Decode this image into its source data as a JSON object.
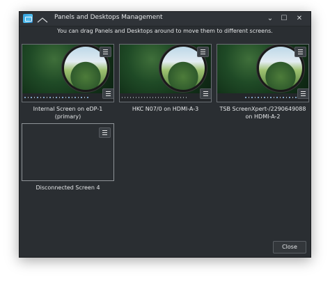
{
  "window": {
    "title": "Panels and Desktops Management",
    "minimize_glyph": "⌄",
    "maximize_glyph": "☐",
    "close_glyph": "✕"
  },
  "hint": "You can drag Panels and Desktops around to move them to different screens.",
  "screens": [
    {
      "label": "Internal Screen on eDP-1 (primary)",
      "icon": "hamburger-menu-icon"
    },
    {
      "label": "HKC N07/0 on HDMI-A-3",
      "icon": "hamburger-menu-icon"
    },
    {
      "label": "TSB ScreenXpert-/2290649088 on HDMI-A-2",
      "icon": "hamburger-menu-icon"
    }
  ],
  "disconnected": {
    "label": "Disconnected Screen 4",
    "icon": "hamburger-menu-icon"
  },
  "buttons": {
    "close_label": "Close"
  },
  "colors": {
    "window_bg": "#2a2e32",
    "titlebar_bg": "#2f3338",
    "border": "#6b7075",
    "text": "#e6e8ea"
  }
}
